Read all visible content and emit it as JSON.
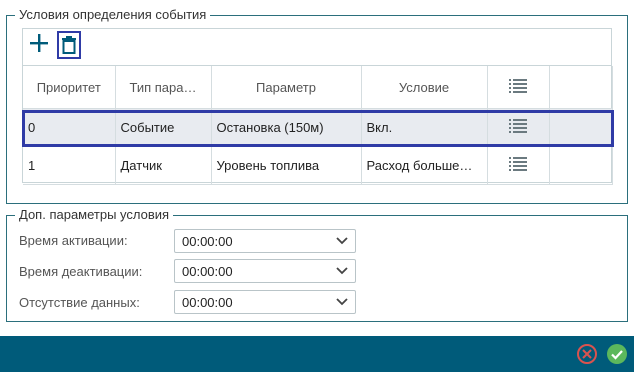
{
  "section_conditions": {
    "legend": "Условия определения события"
  },
  "toolbar": {
    "add_icon": "plus-icon",
    "delete_icon": "trash-icon"
  },
  "table": {
    "columns": [
      "Приоритет",
      "Тип пара…",
      "Параметр",
      "Условие",
      "",
      ""
    ],
    "rows": [
      {
        "priority": "0",
        "type": "Событие",
        "parameter": "Остановка (150м)",
        "condition": "Вкл."
      },
      {
        "priority": "1",
        "type": "Датчик",
        "parameter": "Уровень топлива",
        "condition": "Расход больше…"
      }
    ],
    "column_icon": "list-settings-icon"
  },
  "section_extra": {
    "legend": "Доп. параметры условия",
    "fields": [
      {
        "label": "Время активации:",
        "value": "00:00:00"
      },
      {
        "label": "Время деактивации:",
        "value": "00:00:00"
      },
      {
        "label": "Отсутствие данных:",
        "value": "00:00:00"
      }
    ]
  },
  "footer": {
    "cancel_icon": "cancel-icon",
    "ok_icon": "ok-icon"
  },
  "colors": {
    "accent": "#005b7a",
    "selection": "#2f3ba6",
    "cancel": "#d9534f",
    "ok": "#5cb85c"
  }
}
